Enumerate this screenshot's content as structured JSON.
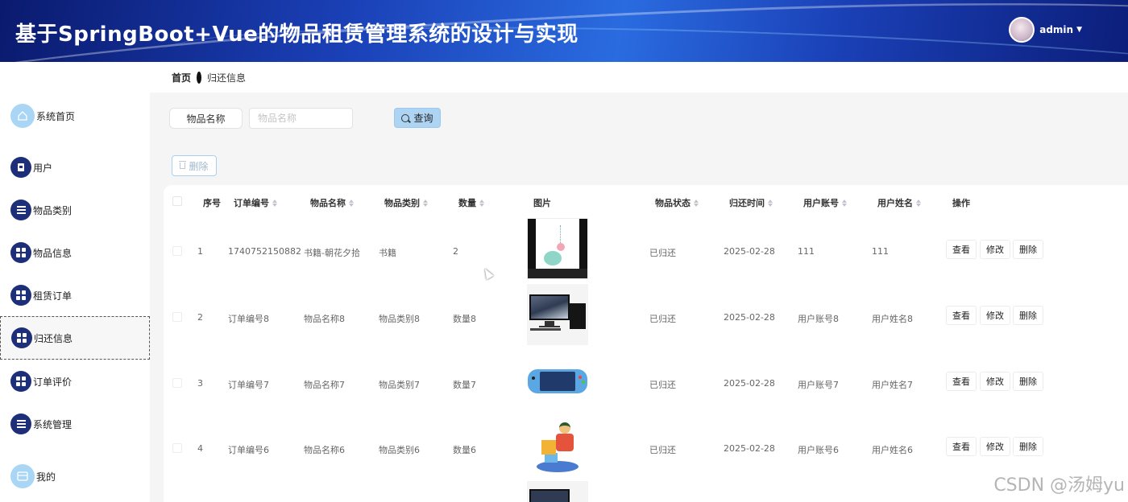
{
  "header": {
    "title": "基于SpringBoot+Vue的物品租赁管理系统的设计与实现",
    "username": "admin"
  },
  "breadcrumb": {
    "home": "首页",
    "current": "归还信息"
  },
  "sidebar": {
    "items": [
      {
        "label": "系统首页",
        "icon": "home-icon"
      },
      {
        "label": "用户",
        "icon": "user-icon"
      },
      {
        "label": "物品类别",
        "icon": "list-icon"
      },
      {
        "label": "物品信息",
        "icon": "grid-icon"
      },
      {
        "label": "租赁订单",
        "icon": "grid-icon"
      },
      {
        "label": "归还信息",
        "icon": "grid-icon",
        "active": true
      },
      {
        "label": "订单评价",
        "icon": "grid-icon"
      },
      {
        "label": "系统管理",
        "icon": "list-icon"
      },
      {
        "label": "我的",
        "icon": "card-icon"
      }
    ]
  },
  "search": {
    "label": "物品名称",
    "placeholder": "物品名称",
    "button": "查询"
  },
  "toolbar": {
    "delete_label": "删除"
  },
  "table": {
    "columns": [
      "序号",
      "订单编号",
      "物品名称",
      "物品类别",
      "数量",
      "图片",
      "物品状态",
      "归还时间",
      "用户账号",
      "用户姓名",
      "操作"
    ],
    "actions": [
      "查看",
      "修改",
      "删除"
    ],
    "rows": [
      {
        "index": "1",
        "order_no": "1740752150882",
        "name": "书籍-朝花夕拾",
        "category": "书籍",
        "qty": "2",
        "status": "已归还",
        "return_time": "2025-02-28",
        "account": "111",
        "user_name": "111"
      },
      {
        "index": "2",
        "order_no": "订单编号8",
        "name": "物品名称8",
        "category": "物品类别8",
        "qty": "数量8",
        "status": "已归还",
        "return_time": "2025-02-28",
        "account": "用户账号8",
        "user_name": "用户姓名8"
      },
      {
        "index": "3",
        "order_no": "订单编号7",
        "name": "物品名称7",
        "category": "物品类别7",
        "qty": "数量7",
        "status": "已归还",
        "return_time": "2025-02-28",
        "account": "用户账号7",
        "user_name": "用户姓名7"
      },
      {
        "index": "4",
        "order_no": "订单编号6",
        "name": "物品名称6",
        "category": "物品类别6",
        "qty": "数量6",
        "status": "已归还",
        "return_time": "2025-02-28",
        "account": "用户账号6",
        "user_name": "用户姓名6"
      }
    ]
  },
  "watermark": "CSDN @汤姆yu"
}
